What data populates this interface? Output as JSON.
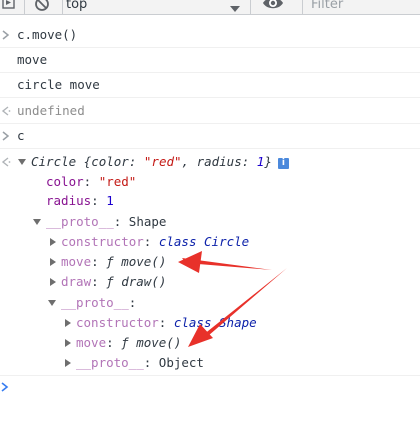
{
  "toolbar": {
    "context": "top",
    "filter_placeholder": "Filter",
    "icons": [
      "execute-icon",
      "block-icon",
      "dropdown-arrow-icon",
      "eye-icon"
    ]
  },
  "console": {
    "command_1": "c.move()",
    "log_1": "move",
    "log_2": "circle move",
    "result_1": "undefined",
    "command_2": "c",
    "object": {
      "summary_class": "Circle",
      "summary_open": " {color: ",
      "summary_color": "\"red\"",
      "summary_mid": ", radius: ",
      "summary_radius": "1",
      "summary_close": "}",
      "info_badge": "i",
      "color_key": "color",
      "color_value": "\"red\"",
      "radius_key": "radius",
      "radius_value": "1",
      "proto_key": "__proto__",
      "proto_value": "Shape",
      "constructor_key": "constructor",
      "constructor_value": "class Circle",
      "move_key": "move",
      "move_value": "ƒ move()",
      "draw_key": "draw",
      "draw_value": "ƒ draw()",
      "proto2_key": "__proto__",
      "constructor2_key": "constructor",
      "constructor2_value": "class Shape",
      "move2_key": "move",
      "move2_value": "ƒ move()",
      "proto3_key": "__proto__",
      "proto3_value": "Object"
    },
    "gutter_in": "<",
    "gutter_out": ">",
    "gutter_result": "<·"
  },
  "colors": {
    "annotation_arrow": "#e8312a",
    "prompt_blue": "#367cf1",
    "prototype_key": "#b274b7",
    "own_key": "#881391",
    "string": "#c41a16",
    "number": "#1c00cf"
  }
}
